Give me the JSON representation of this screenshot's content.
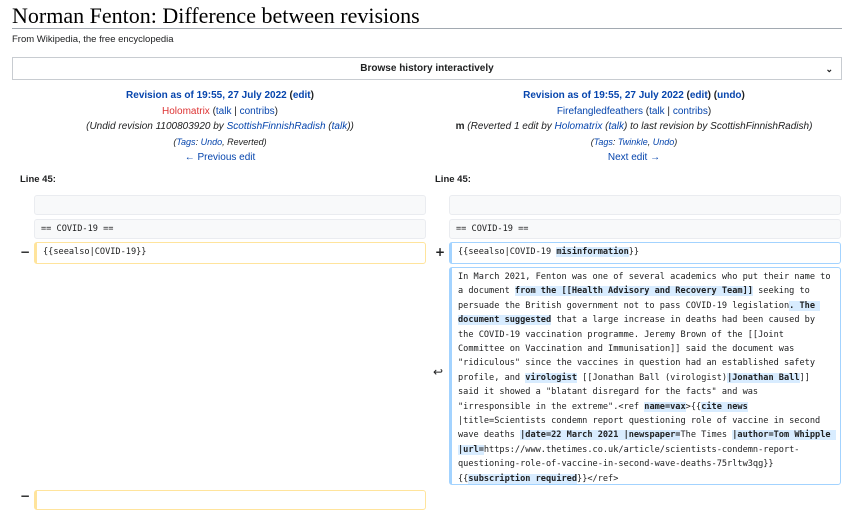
{
  "page": {
    "title": "Norman Fenton: Difference between revisions",
    "tagline": "From Wikipedia, the free encyclopedia"
  },
  "browse": {
    "label": "Browse history interactively",
    "chevron": "⌄"
  },
  "left_rev": {
    "heading": "Revision as of 19:55, 27 July 2022",
    "edit": "edit",
    "user": "Holomatrix",
    "talk": "talk",
    "contribs": "contribs",
    "summary_prefix": "(Undid revision 1100803920 by ",
    "summary_user": "ScottishFinnishRadish",
    "summary_talk": "talk",
    "tags_label": "Tags",
    "tag1": "Undo",
    "tag2": ", Reverted)",
    "nav": "← Previous edit"
  },
  "right_rev": {
    "heading": "Revision as of 19:55, 27 July 2022",
    "edit": "edit",
    "undo": "undo",
    "user": "Firefangledfeathers",
    "talk": "talk",
    "contribs": "contribs",
    "minor": "m",
    "summary_prefix": " (Reverted 1 edit by ",
    "summary_user": "Holomatrix",
    "summary_talk": "talk",
    "summary_suffix": ") to last revision by ScottishFinnishRadish)",
    "tags_label": "Tags",
    "tag1": "Twinkle",
    "tag2": "Undo",
    "nav": "Next edit →"
  },
  "diff": {
    "line_left": "Line 45:",
    "line_right": "Line 45:",
    "context_line": "== COVID-19 ==",
    "deleted_line": "{{seealso|COVID-19}}",
    "added_line_a": "{{seealso|COVID-19 ",
    "added_line_hl": "misinformation",
    "added_line_b": "}}",
    "minus": "−",
    "plus": "+",
    "moved_arrow": "↩",
    "para": {
      "t1": "In March 2021, Fenton was one of several academics who put their name to a document ",
      "h1": "from the [[Health Advisory and Recovery Team]]",
      "t2": " seeking to persuade the British government not to pass COVID-19 legislation",
      "h2": ". The document suggested",
      "t3": " that a large increase in deaths had been caused by the COVID-19 vaccination programme. Jeremy Brown of the [[Joint Committee on Vaccination and Immunisation]] said the document was \"ridiculous\" since the vaccines in question had an established safety profile, and ",
      "h3": "virologist",
      "t4": " [[Jonathan Ball (virologist)",
      "h4": "|Jonathan Ball",
      "t5": "]] said it showed a \"blatant disregard for the facts\" and was \"irresponsible in the extreme\".<ref ",
      "h5": "name=vax",
      "t6": ">{{",
      "h6": "cite news",
      "t7": " |title=Scientists condemn report questioning role of vaccine in second wave deaths ",
      "h7": "|date=22 March 2021 |newspaper=",
      "t8": "The Times ",
      "h8": "|author=Tom Whipple |url=",
      "t9": "https://www.thetimes.co.uk/article/scientists-condemn-report-questioning-role-of-vaccine-in-second-wave-deaths-75rltw3qg}} {{",
      "h9": "subscription required",
      "t10": "}}</ref>"
    }
  }
}
